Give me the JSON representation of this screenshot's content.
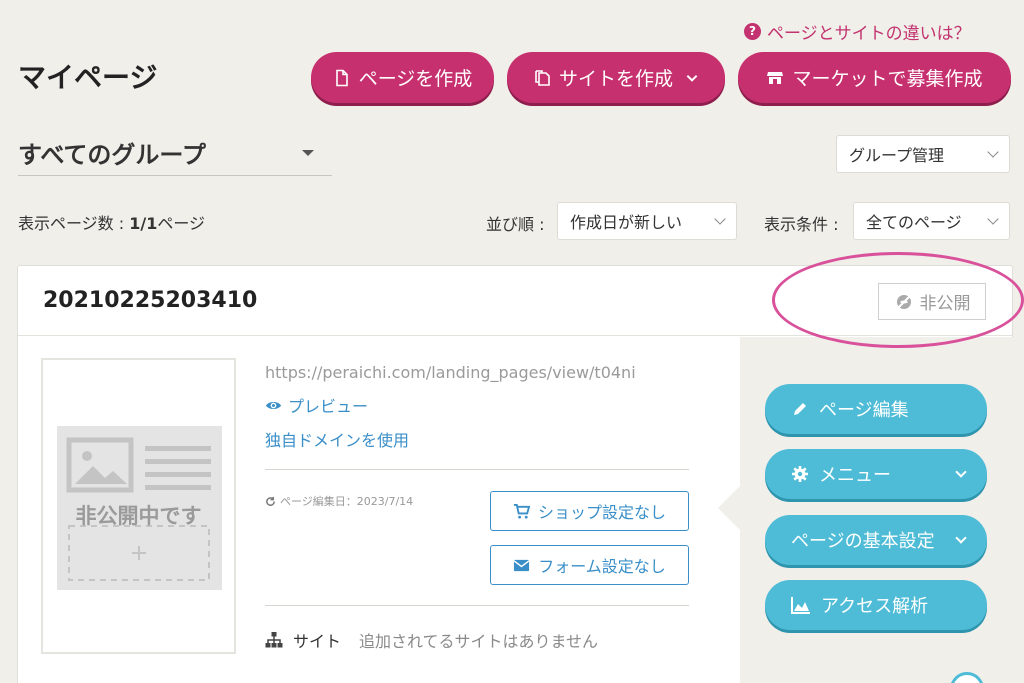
{
  "header": {
    "help_link": "ページとサイトの違いは？",
    "page_title": "マイページ",
    "create_page_button": "ページを作成",
    "create_site_button": "サイトを作成",
    "market_button": "マーケットで募集作成"
  },
  "group_select": {
    "selected": "すべてのグループ"
  },
  "group_manage": {
    "label": "グループ管理"
  },
  "filters": {
    "page_count_prefix": "表示ページ数 : ",
    "page_count_value": "1/1",
    "page_count_suffix": "ページ",
    "sort_label": "並び順 :",
    "sort_value": "作成日が新しい",
    "condition_label": "表示条件 :",
    "condition_value": "全てのページ"
  },
  "card": {
    "title": "20210225203410",
    "status_badge": "非公開",
    "thumbnail_text": "非公開中です",
    "url": "https://peraichi.com/landing_pages/view/t04ni",
    "preview_link": "プレビュー",
    "domain_link": "独自ドメインを使用",
    "edit_date": "ページ編集日：2023/7/14",
    "shop_button": "ショップ設定なし",
    "form_button": "フォーム設定なし",
    "site_label": "サイト",
    "site_empty": "追加されてるサイトはありません"
  },
  "actions": {
    "edit_page": "ページ編集",
    "menu": "メニュー",
    "basic_settings": "ページの基本設定",
    "analytics": "アクセス解析"
  },
  "colors": {
    "accent_pink": "#c7306f",
    "accent_teal": "#4ebcd6",
    "link_blue": "#3a8fc8",
    "highlight_ellipse": "#d8519a"
  }
}
